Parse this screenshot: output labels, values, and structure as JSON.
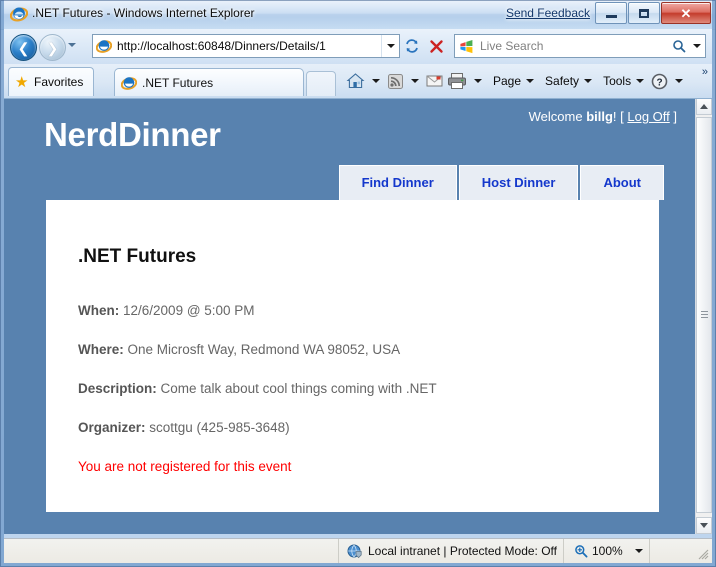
{
  "browser": {
    "title": ".NET Futures - Windows Internet Explorer",
    "send_feedback": "Send Feedback",
    "window_buttons": {
      "minimize": "minimize-button",
      "maximize": "maximize-button",
      "close": "close-button"
    },
    "address": {
      "url": "http://localhost:60848/Dinners/Details/1",
      "favicon": "internet-explorer-icon"
    },
    "search": {
      "placeholder": "Live Search",
      "logo": "windows-logo-icon"
    },
    "favorites_label": "Favorites",
    "tab": {
      "title": ".NET Futures",
      "favicon": "internet-explorer-icon"
    },
    "command_bar": {
      "home": "home-icon",
      "feeds": "rss-feed-icon",
      "read_mail": "mail-icon",
      "print": "printer-icon",
      "page": "Page",
      "safety": "Safety",
      "tools": "Tools",
      "help": "help-icon",
      "overflow": "»"
    },
    "status": {
      "zone": "Local intranet | Protected Mode: Off",
      "zone_icon": "globe-shield-icon",
      "zoom": "100%",
      "zoom_icon": "magnifier-icon"
    }
  },
  "page": {
    "logo": "NerdDinner",
    "welcome": {
      "prefix": "Welcome ",
      "user": "billg",
      "suffix": "! [ ",
      "logoff": "Log Off",
      "tail": " ]"
    },
    "menu": [
      {
        "label": "Find Dinner"
      },
      {
        "label": "Host Dinner"
      },
      {
        "label": "About"
      }
    ],
    "dinner": {
      "title": ".NET Futures",
      "when_label": "When:",
      "when_value": "12/6/2009 @ 5:00 PM",
      "where_label": "Where:",
      "where_value": "One Microsft Way, Redmond WA 98052, USA",
      "description_label": "Description:",
      "description_value": "Come talk about cool things coming with .NET",
      "organizer_label": "Organizer:",
      "organizer_value": "scottgu (425-985-3648)",
      "registration_status": "You are not registered for this event"
    }
  },
  "colors": {
    "page_background": "#5882af",
    "content_background": "#ffffff",
    "menu_text": "#1438cc",
    "alert_text": "#ff0000",
    "titlebar_text": "#0c0c0c"
  }
}
